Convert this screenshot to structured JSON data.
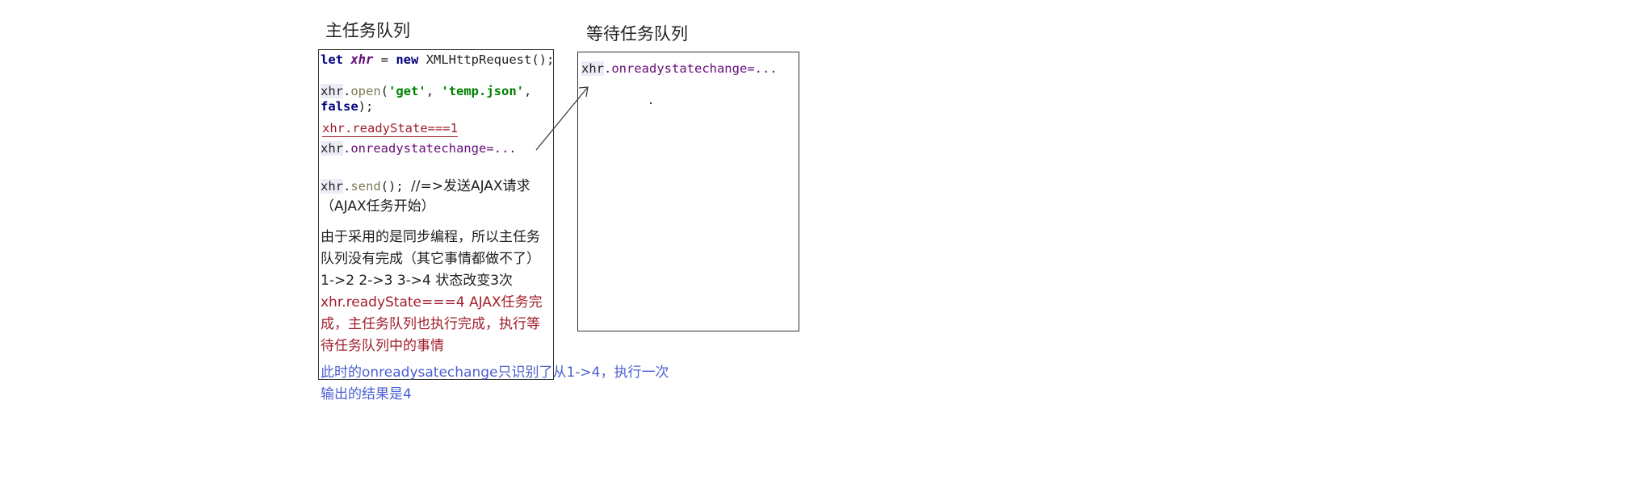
{
  "main_queue": {
    "title": "主任务队列",
    "code_let_kw": "let",
    "code_let_var": "xhr",
    "code_let_eq": " = ",
    "code_let_new": "new",
    "code_let_ctor": " XMLHttpRequest();",
    "open_obj": "xhr",
    "open_dot": ".",
    "open_fn": "open",
    "open_paren": "(",
    "open_arg1": "'get'",
    "open_comma1": ", ",
    "open_arg2": "'temp.json'",
    "open_comma2": ",",
    "open_arg3": "false",
    "open_end": ");",
    "ready_state_1": "xhr.readyState===1",
    "onready_obj": "xhr",
    "onready_prop": ".onreadystatechange=...",
    "send_obj": "xhr",
    "send_dot": ".",
    "send_fn": "send",
    "send_end": "(); ",
    "send_comment": "//=>发送AJAX请求",
    "send_comment_2": "（AJAX任务开始）",
    "sync_note_1": "由于采用的是同步编程，所以主任务",
    "sync_note_2": "队列没有完成（其它事情都做不了）",
    "state_changes": "1->2  2->3  3->4  状态改变3次",
    "ready_state_4_line1": "xhr.readyState===4 AJAX任务完",
    "ready_state_4_line2": "成，主任务队列也执行完成，执行等",
    "ready_state_4_line3": "待任务队列中的事情"
  },
  "wait_queue": {
    "title": "等待任务队列",
    "onready_obj": "xhr",
    "onready_prop": ".onreadystatechange=..."
  },
  "footer": {
    "line1": "此时的onreadysatechange只识别了从1->4，执行一次",
    "line2": "输出的结果是4"
  },
  "colors": {
    "keyword": "#000080",
    "variable": "#660e7a",
    "string": "#008000",
    "red_text": "#a11d2b",
    "blue_text": "#4a5fd0"
  }
}
